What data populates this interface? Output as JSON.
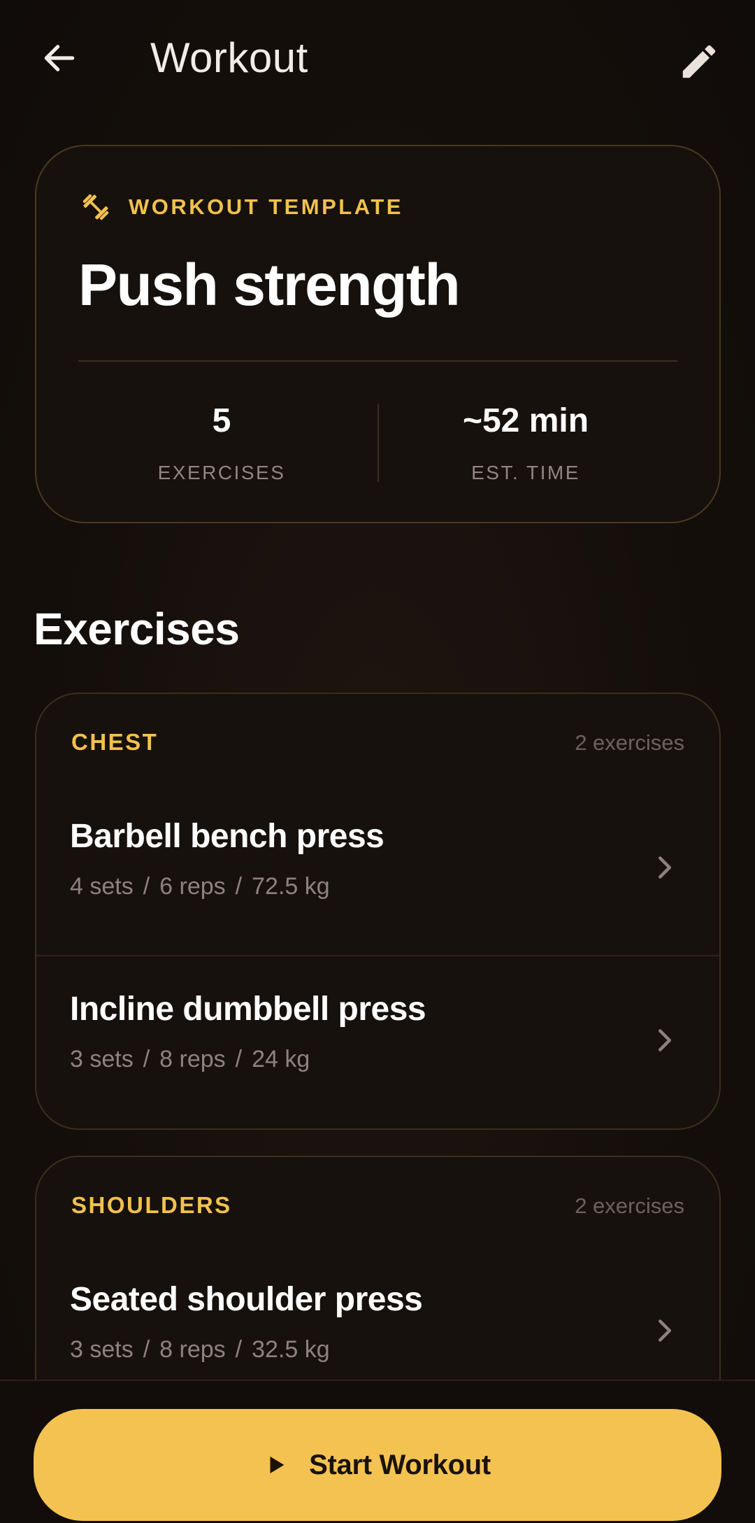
{
  "header": {
    "title": "Workout",
    "back_icon": "arrow-left-icon",
    "edit_icon": "pencil-icon"
  },
  "template": {
    "label": "WORKOUT TEMPLATE",
    "label_icon": "dumbbell-icon",
    "name": "Push strength",
    "stats": [
      {
        "value": "5",
        "label": "EXERCISES"
      },
      {
        "value": "~52 min",
        "label": "EST. TIME"
      }
    ]
  },
  "section_title": "Exercises",
  "groups": [
    {
      "name": "CHEST",
      "count": "2 exercises",
      "exercises": [
        {
          "name": "Barbell bench press",
          "sets": "4 sets",
          "reps": "6 reps",
          "weight": "72.5 kg"
        },
        {
          "name": "Incline dumbbell press",
          "sets": "3 sets",
          "reps": "8 reps",
          "weight": "24 kg"
        }
      ]
    },
    {
      "name": "SHOULDERS",
      "count": "2 exercises",
      "exercises": [
        {
          "name": "Seated shoulder press",
          "sets": "3 sets",
          "reps": "8 reps",
          "weight": "32.5 kg"
        }
      ]
    }
  ],
  "meta_separator": "/",
  "action": {
    "start_label": "Start Workout",
    "start_icon": "play-icon"
  },
  "colors": {
    "accent": "#f2c14e",
    "button": "#f4c250",
    "background": "#140f0b",
    "card": "#17110d"
  }
}
